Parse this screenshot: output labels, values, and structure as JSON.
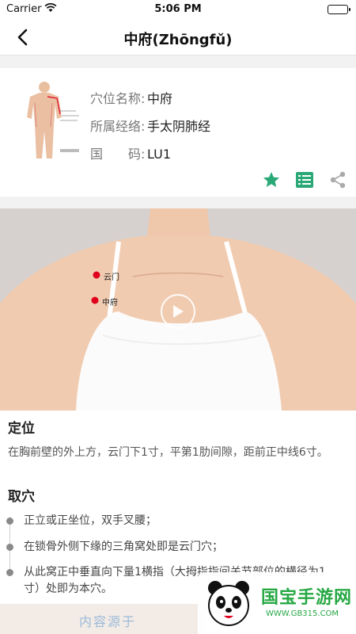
{
  "status": {
    "carrier": "Carrier",
    "time": "5:06 PM"
  },
  "nav": {
    "title": "中府(Zhōngfǔ)"
  },
  "info": {
    "name_label": "穴位名称:",
    "name_value": "中府",
    "meridian_label": "所属经络:",
    "meridian_value": "手太阴肺经",
    "code_label": "国　　码:",
    "code_value": "LU1"
  },
  "video": {
    "point_labels": [
      "云门",
      "中府"
    ]
  },
  "location": {
    "title": "定位",
    "text": "在胸前壁的外上方，云门下1寸，平第1肋间隙，距前正中线6寸。"
  },
  "method": {
    "title": "取穴",
    "steps": [
      "正立或正坐位，双手叉腰；",
      "在锁骨外侧下缘的三角窝处即是云门穴；",
      "从此窝正中垂直向下量1横指（大拇指指间关节部位的横径为1寸）处即为本穴。"
    ]
  },
  "watermark": {
    "name": "国宝手游网",
    "url": "WWW.GB315.COM"
  },
  "bottom": {
    "text": "内容源于"
  },
  "colors": {
    "accent": "#2aa876",
    "point": "#e0001b"
  }
}
